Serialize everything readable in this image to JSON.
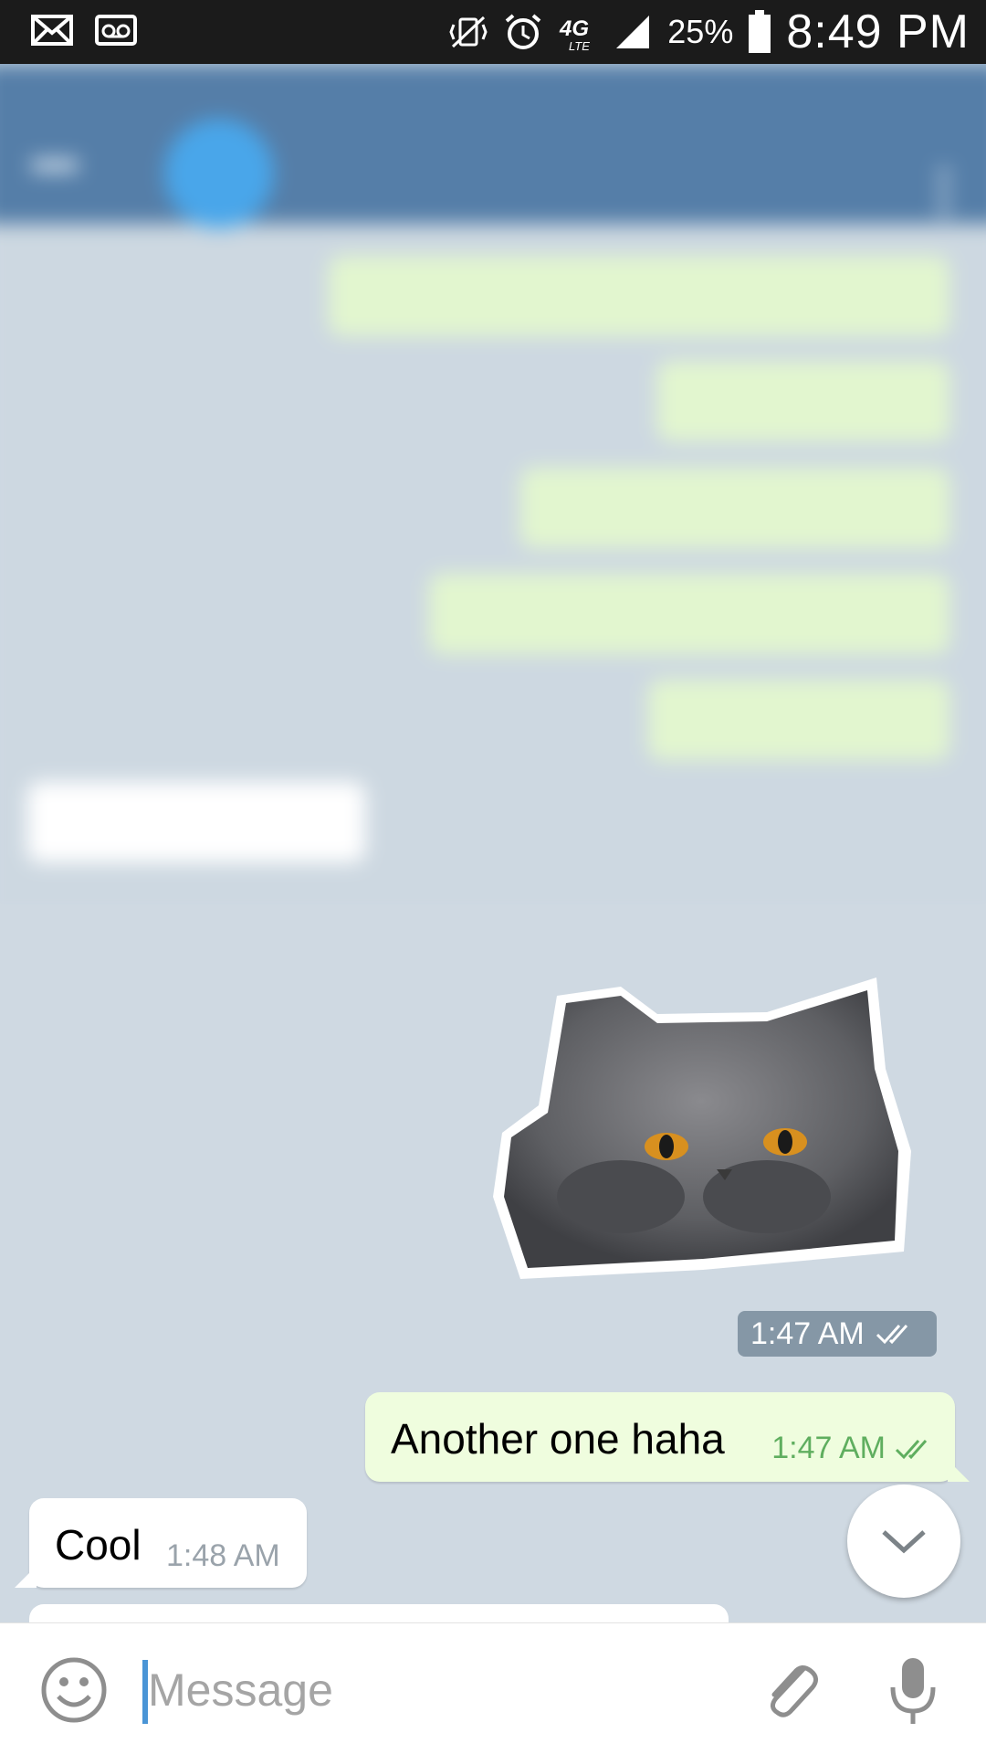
{
  "status_bar": {
    "battery": "25%",
    "time": "8:49 PM",
    "network": "4G LTE",
    "icons": [
      "mail-icon",
      "voicemail-icon",
      "vibrate-icon",
      "alarm-icon",
      "network-4g-icon",
      "signal-icon",
      "battery-icon"
    ]
  },
  "chat": {
    "sticker": {
      "description_icon": "cat-sticker"
    },
    "sticker_time": "1:47 AM",
    "messages": [
      {
        "direction": "out",
        "text": "Another one haha",
        "time": "1:47 AM",
        "status": "read"
      },
      {
        "direction": "in",
        "text": "Cool",
        "time": "1:48 AM"
      }
    ]
  },
  "input_bar": {
    "placeholder": "Message",
    "icons": [
      "emoji-icon",
      "attach-icon",
      "mic-icon"
    ]
  },
  "colors": {
    "header": "#557ea8",
    "outgoing_bubble": "#effdde",
    "incoming_bubble": "#ffffff",
    "read_check": "#5fae5f",
    "cursor": "#4a95d6",
    "chat_background": "#cfd9e2"
  }
}
